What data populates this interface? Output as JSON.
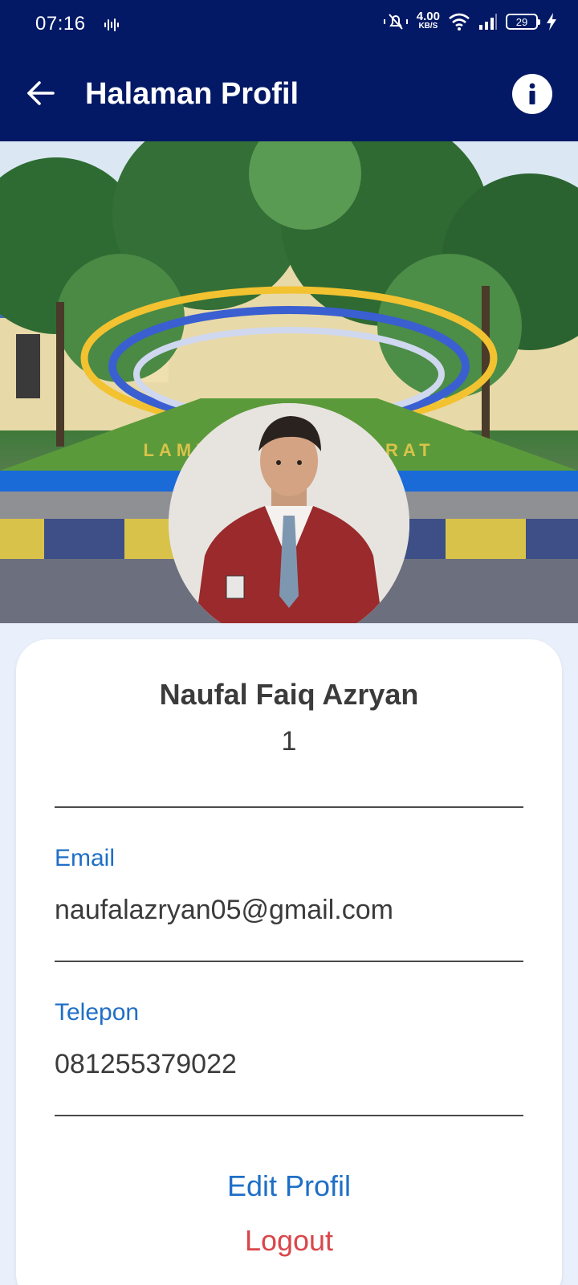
{
  "status_bar": {
    "time": "07:16",
    "speed_value": "4.00",
    "speed_unit": "KB/S",
    "battery": "29"
  },
  "app_bar": {
    "title": "Halaman Profil"
  },
  "profile": {
    "name": "Naufal Faiq Azryan",
    "id": "1"
  },
  "fields": {
    "email_label": "Email",
    "email_value": "naufalazryan05@gmail.com",
    "phone_label": "Telepon",
    "phone_value": "081255379022"
  },
  "actions": {
    "edit": "Edit Profil",
    "logout": "Logout"
  },
  "colors": {
    "primary_dark": "#031965",
    "link_blue": "#1f6fc6",
    "logout_red": "#d9464a",
    "text": "#3b3b3b"
  }
}
